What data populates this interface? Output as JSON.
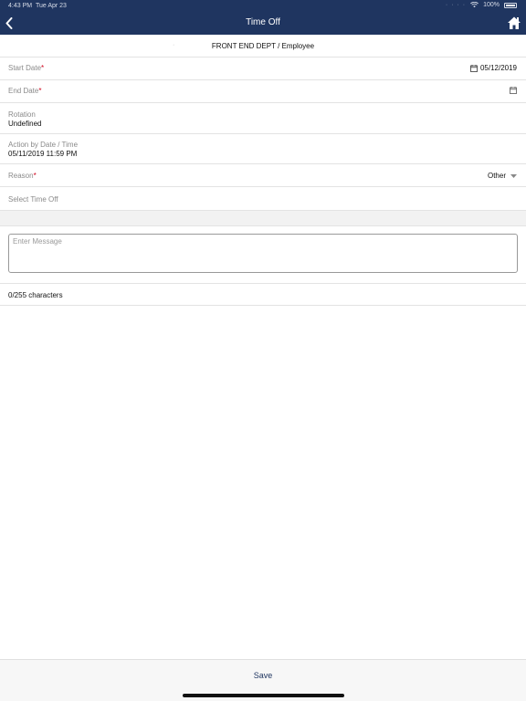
{
  "status_bar": {
    "time": "4:43 PM",
    "date": "Tue Apr 23",
    "signal_dots": "· · · ·",
    "battery": "100%"
  },
  "header": {
    "title": "Time Off"
  },
  "dept_bar": {
    "text": "FRONT END DEPT / Employee"
  },
  "form": {
    "start_date": {
      "label": "Start Date",
      "required_mark": "*",
      "value": "05/12/2019"
    },
    "end_date": {
      "label": "End Date",
      "required_mark": "*",
      "value": ""
    },
    "rotation": {
      "label": "Rotation",
      "value": "Undefined"
    },
    "action_by": {
      "label": "Action by Date / Time",
      "value": "05/11/2019 11:59 PM"
    },
    "reason": {
      "label": "Reason",
      "required_mark": "*",
      "value": "Other"
    },
    "select_time_off": {
      "label": "Select Time Off"
    }
  },
  "message": {
    "placeholder": "Enter Message",
    "value": "",
    "counter": "0/255 characters"
  },
  "footer": {
    "save_label": "Save"
  },
  "colors": {
    "header_bg": "#1f3560",
    "required": "#d0021b"
  }
}
